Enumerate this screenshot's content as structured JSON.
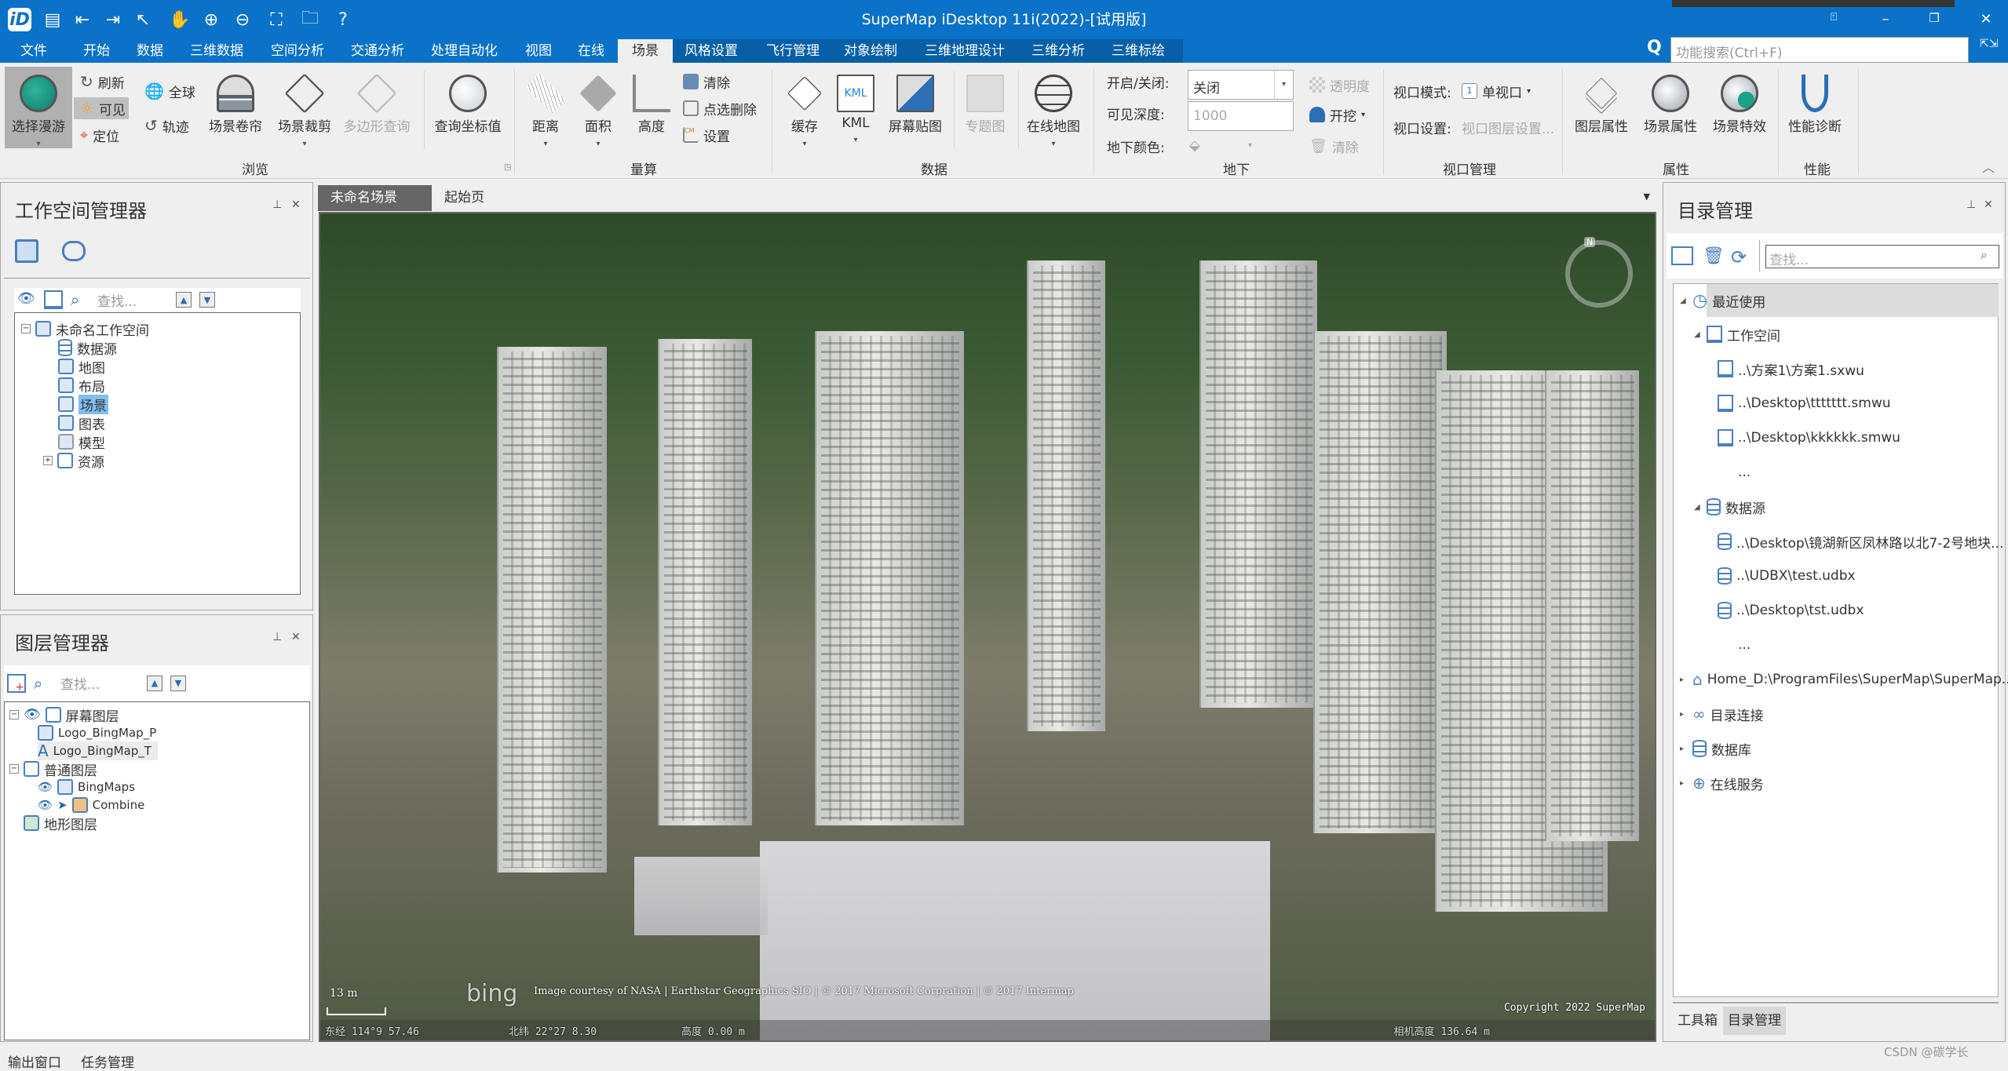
{
  "app": {
    "title": "SuperMap iDesktop 11i(2022)-[试用版]",
    "quick_access": [
      "app-logo",
      "save-icon",
      "import-icon",
      "export-icon",
      "select-pointer-icon",
      "pan-hand-icon",
      "zoom-in-icon",
      "zoom-out-icon",
      "full-extent-icon",
      "open-folder-icon",
      "help-icon"
    ],
    "window_buttons": [
      "ribbon-display-icon",
      "minimize-icon",
      "restore-icon",
      "close-icon"
    ]
  },
  "menu": {
    "tabs": [
      "文件",
      "开始",
      "数据",
      "三维数据",
      "空间分析",
      "交通分析",
      "处理自动化",
      "视图",
      "在线",
      "场景",
      "风格设置",
      "飞行管理",
      "对象绘制",
      "三维地理设计",
      "三维分析",
      "三维标绘"
    ],
    "active": "场景",
    "search_placeholder": "功能搜索(Ctrl+F)"
  },
  "ribbon": {
    "browse": {
      "group": "浏览",
      "select_roam": "选择漫游",
      "refresh": "刷新",
      "visible": "可见",
      "locate": "定位",
      "globe": "全球",
      "track": "轨迹",
      "scene_swipe": "场景卷帘",
      "scene_clip": "场景裁剪",
      "polygon_query": "多边形查询",
      "query_coord": "查询坐标值"
    },
    "measure": {
      "group": "量算",
      "distance": "距离",
      "area": "面积",
      "height": "高度",
      "clear": "清除",
      "pick_delete": "点选删除",
      "settings": "设置"
    },
    "data": {
      "group": "数据",
      "cache": "缓存",
      "kml": "KML",
      "screen_image": "屏幕贴图",
      "thematic": "专题图",
      "online_map": "在线地图"
    },
    "underground": {
      "group": "地下",
      "onoff_label": "开启/关闭:",
      "onoff_value": "关闭",
      "depth_label": "可见深度:",
      "depth_value": "1000",
      "color_label": "地下颜色:",
      "transparency": "透明度",
      "excavate": "开挖",
      "clear": "清除"
    },
    "viewport": {
      "group": "视口管理",
      "mode_label": "视口模式:",
      "mode_value": "单视口",
      "mode_icon_number": "1",
      "settings_label": "视口设置:",
      "settings_value": "视口图层设置..."
    },
    "properties": {
      "group": "属性",
      "layer_props": "图层属性",
      "scene_props": "场景属性",
      "scene_effects": "场景特效"
    },
    "performance": {
      "group": "性能",
      "diagnose": "性能诊断"
    }
  },
  "workspace_manager": {
    "title": "工作空间管理器",
    "search_placeholder": "查找...",
    "root": "未命名工作空间",
    "items": [
      "数据源",
      "地图",
      "布局",
      "场景",
      "图表",
      "模型",
      "资源"
    ],
    "selected": "场景"
  },
  "layer_manager": {
    "title": "图层管理器",
    "search_placeholder": "查找...",
    "groups": [
      {
        "name": "屏幕图层",
        "children": [
          "Logo_BingMap_P",
          "Logo_BingMap_T"
        ]
      },
      {
        "name": "普通图层",
        "children": [
          "BingMaps",
          "Combine"
        ]
      },
      {
        "name": "地形图层",
        "children": []
      }
    ]
  },
  "document_tabs": [
    {
      "label": "未命名场景",
      "active": true
    },
    {
      "label": "起始页",
      "active": false
    }
  ],
  "scene": {
    "scale_label": "13 m",
    "attribution": "Image courtesy of NASA | Earthstar Geographics SIO | © 2017 Microsoft Corpration | © 2017 Intermap",
    "bing_logo": "bing",
    "longitude": "东经 114°9    57.46",
    "latitude": "北纬 22°27    8.30",
    "altitude": "高度 0.00 m",
    "copyright": "Copyright 2022 SuperMap",
    "camera_height": "相机高度 136.64 m",
    "compass_label": "N"
  },
  "catalog": {
    "title": "目录管理",
    "search_placeholder": "查找...",
    "recent": "最近使用",
    "workspace_group": "工作空间",
    "workspaces": [
      "..\\方案1\\方案1.sxwu",
      "..\\Desktop\\ttttttt.smwu",
      "..\\Desktop\\kkkkkk.smwu",
      "..."
    ],
    "datasource_group": "数据源",
    "datasources": [
      "..\\Desktop\\镜湖新区凤林路以北7-2号地块...",
      "..\\UDBX\\test.udbx",
      "..\\Desktop\\tst.udbx",
      "..."
    ],
    "roots": [
      "Home_D:\\ProgramFiles\\SuperMap\\SuperMap...",
      "目录连接",
      "数据库",
      "在线服务"
    ],
    "bottom_tabs": [
      "工具箱",
      "目录管理"
    ],
    "active_bottom_tab": "目录管理"
  },
  "bottom": {
    "tabs": [
      "输出窗口",
      "任务管理"
    ],
    "watermark": "CSDN @碳学长"
  }
}
